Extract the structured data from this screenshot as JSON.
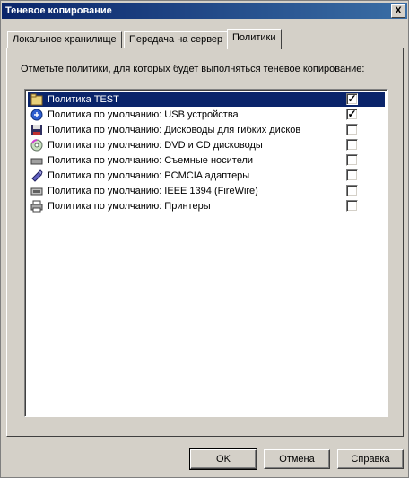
{
  "window": {
    "title": "Теневое копирование",
    "close_glyph": "X"
  },
  "tabs": [
    {
      "label": "Локальное хранилище",
      "active": false
    },
    {
      "label": "Передача на сервер",
      "active": false
    },
    {
      "label": "Политики",
      "active": true
    }
  ],
  "instruction": "Отметьте политики, для которых будет выполняться теневое копирование:",
  "policies": [
    {
      "label": "Политика TEST",
      "checked": true,
      "selected": true,
      "icon": "folder-icon"
    },
    {
      "label": "Политика по умолчанию: USB устройства",
      "checked": true,
      "selected": false,
      "icon": "usb-icon"
    },
    {
      "label": "Политика по умолчанию: Дисководы для гибких дисков",
      "checked": false,
      "selected": false,
      "icon": "floppy-icon"
    },
    {
      "label": "Политика по умолчанию: DVD и CD дисководы",
      "checked": false,
      "selected": false,
      "icon": "cd-icon"
    },
    {
      "label": "Политика по умолчанию: Съемные носители",
      "checked": false,
      "selected": false,
      "icon": "removable-drive-icon"
    },
    {
      "label": "Политика по умолчанию: PCMCIA адаптеры",
      "checked": false,
      "selected": false,
      "icon": "pcmcia-icon"
    },
    {
      "label": "Политика по умолчанию: IEEE 1394 (FireWire)",
      "checked": false,
      "selected": false,
      "icon": "firewire-icon"
    },
    {
      "label": "Политика по умолчанию: Принтеры",
      "checked": false,
      "selected": false,
      "icon": "printer-icon"
    }
  ],
  "buttons": {
    "ok": "OK",
    "cancel": "Отмена",
    "help": "Справка"
  },
  "colors": {
    "titlebar": "#0a246a",
    "selection": "#0a246a",
    "face": "#d4d0c8"
  }
}
